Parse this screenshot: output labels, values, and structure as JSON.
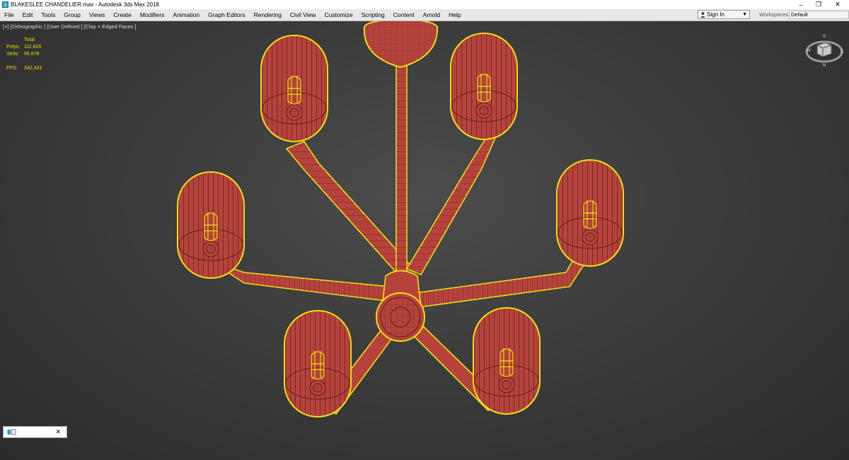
{
  "window": {
    "title": "BLAKESLEE CHANDELIER.max - Autodesk 3ds Max 2018",
    "minimize_glyph": "–",
    "restore_glyph": "❐",
    "close_glyph": "✕"
  },
  "menu": {
    "items": [
      "File",
      "Edit",
      "Tools",
      "Group",
      "Views",
      "Create",
      "Modifiers",
      "Animation",
      "Graph Editors",
      "Rendering",
      "Civil View",
      "Customize",
      "Scripting",
      "Content",
      "Arnold",
      "Help"
    ]
  },
  "account": {
    "sign_in_label": "Sign In",
    "workspaces_label": "Workspaces:",
    "workspace_value": "Default"
  },
  "viewport": {
    "label": "[+] [Orthographic ] [User Defined ] [Clay + Edged Faces ]",
    "stats": {
      "total_label": "Total",
      "polys_label": "Polys:",
      "polys_value": "111 816",
      "verts_label": "Verts:",
      "verts_value": "56 878",
      "fps_label": "FPS:",
      "fps_value": "342,431"
    },
    "viewcube": {
      "n": "S",
      "e": "E",
      "w": "W",
      "s": "N"
    }
  },
  "mini_panel": {
    "close_glyph": "✕"
  },
  "colors": {
    "viewport_bg": "#3c3c3c",
    "model_fill": "#b5433c",
    "wire": "#5a1b16",
    "selection": "#f2e011",
    "stats_text": "#e8e000"
  },
  "icons": [
    "app-icon",
    "user-icon",
    "dropdown-arrow-icon",
    "viewcube-icon",
    "mini-panel-icon",
    "close-icon"
  ]
}
